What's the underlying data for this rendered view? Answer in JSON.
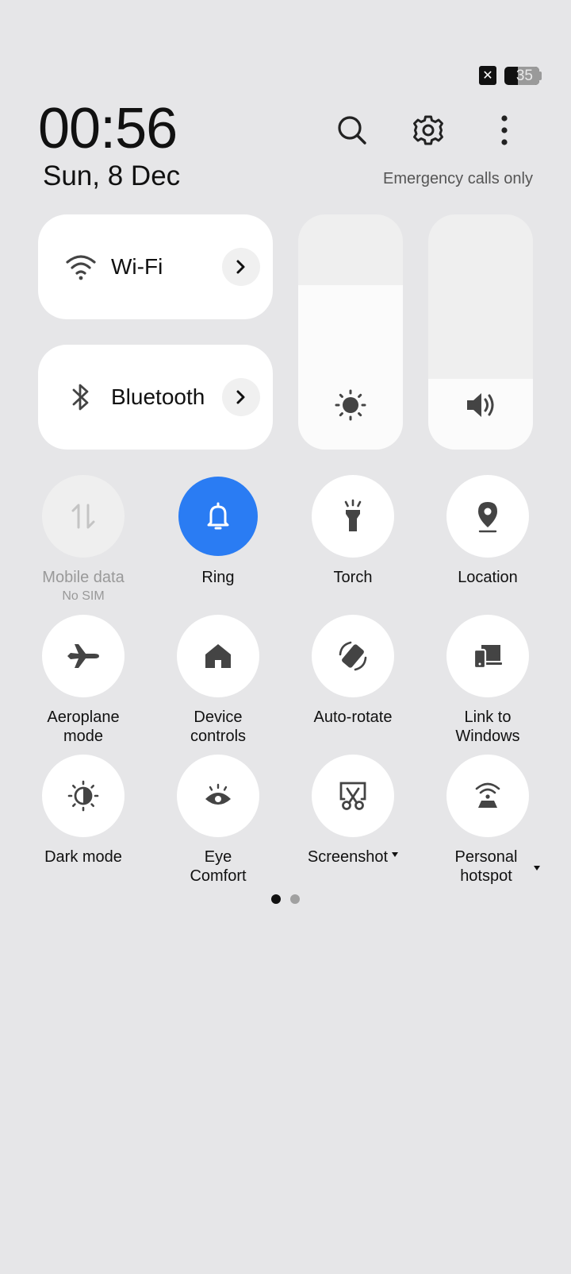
{
  "status_bar": {
    "battery_level": "35"
  },
  "header": {
    "time": "00:56",
    "date": "Sun, 8 Dec",
    "network_status": "Emergency calls only"
  },
  "big_tiles": {
    "wifi": {
      "label": "Wi-Fi"
    },
    "bluetooth": {
      "label": "Bluetooth"
    }
  },
  "sliders": {
    "brightness_level": 0.7,
    "volume_level": 0.3
  },
  "tiles": [
    {
      "label": "Mobile data",
      "sub": "No SIM",
      "icon": "mobile-data-icon",
      "state": "disabled"
    },
    {
      "label": "Ring",
      "icon": "bell-icon",
      "state": "active"
    },
    {
      "label": "Torch",
      "icon": "torch-icon",
      "state": "off"
    },
    {
      "label": "Location",
      "icon": "location-icon",
      "state": "off"
    },
    {
      "label": "Aeroplane mode",
      "icon": "airplane-icon",
      "state": "off"
    },
    {
      "label": "Device controls",
      "icon": "home-icon",
      "state": "off"
    },
    {
      "label": "Auto-rotate",
      "icon": "auto-rotate-icon",
      "state": "off"
    },
    {
      "label": "Link to Windows",
      "icon": "link-to-windows-icon",
      "state": "off"
    },
    {
      "label": "Dark mode",
      "icon": "dark-mode-icon",
      "state": "off"
    },
    {
      "label": "Eye Comfort",
      "icon": "eye-icon",
      "state": "off"
    },
    {
      "label": "Screenshot",
      "icon": "screenshot-icon",
      "state": "off"
    },
    {
      "label": "Personal hotspot",
      "icon": "hotspot-icon",
      "state": "off"
    }
  ],
  "pager": {
    "current": 1,
    "total": 2
  },
  "colors": {
    "accent": "#2a7cf3",
    "background": "#e6e6e8",
    "tile": "#ffffff"
  }
}
